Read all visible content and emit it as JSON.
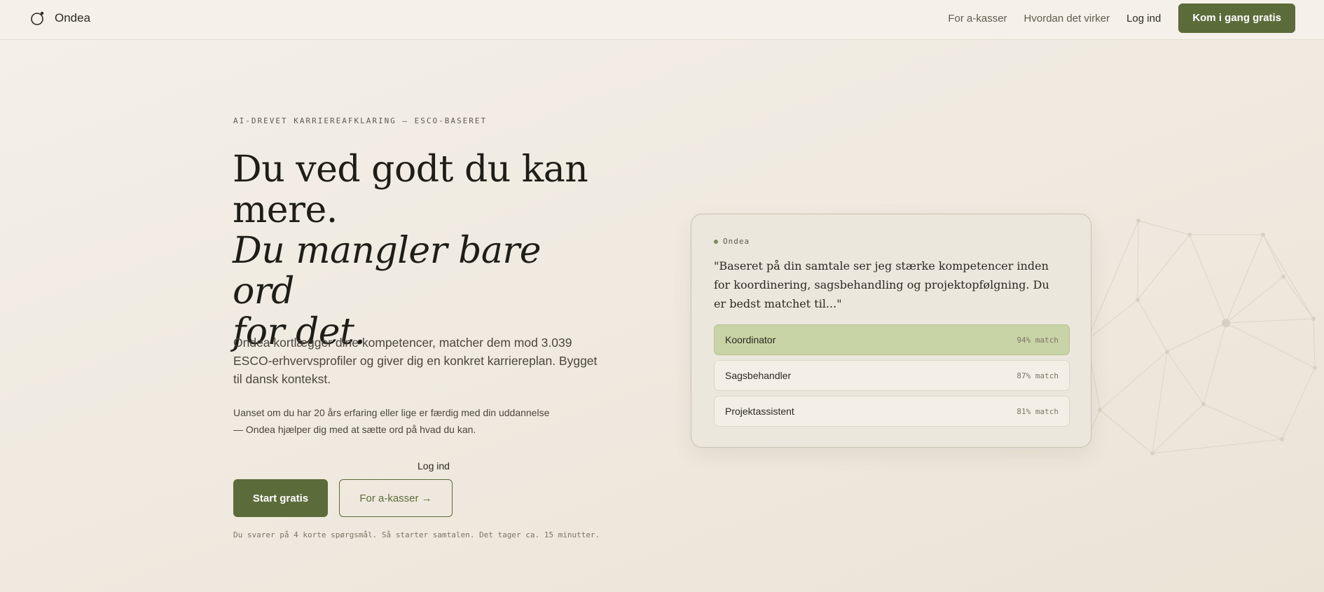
{
  "brand": {
    "name": "Ondea",
    "icon": "ondea-logo-icon"
  },
  "nav": {
    "links": [
      "For a-kasser",
      "Hvordan det virker"
    ],
    "login": "Log ind",
    "cta": "Kom i gang gratis"
  },
  "hero": {
    "eyebrow": "AI-DREVET KARRIEREAFKLARING — ESCO-BASERET",
    "headline_line1": "Du ved godt du kan",
    "headline_line2": "mere.",
    "headline_line3": "Du mangler bare ord",
    "headline_line4": "for det.",
    "lead": "Ondea kortlægger dine kompetencer, matcher dem mod 3.039 ESCO-erhvervsprofiler og giver dig en konkret karriereplan. Bygget til dansk kontekst.",
    "sub": "Uanset om du har 20 års erfaring eller lige er færdig med din uddannelse — Ondea hjælper dig med at sætte ord på hvad du kan.",
    "login_link": "Log ind",
    "primary_button": "Start gratis",
    "secondary_button": "For a-kasser →",
    "note": "Du svarer på 4 korte spørgsmål. Så starter samtalen. Det tager ca. 15 minutter."
  },
  "card": {
    "badge": "Ondea",
    "quote": "\"Baseret på din samtale ser jeg stærke kompetencer inden for koordinering, sagsbehandling og projektopfølgning. Du er bedst matchet til...\"",
    "matches": [
      {
        "name": "Koordinator",
        "score": "94% match"
      },
      {
        "name": "Sagsbehandler",
        "score": "87% match"
      },
      {
        "name": "Projektassistent",
        "score": "81% match"
      }
    ]
  },
  "colors": {
    "accent": "#5c6b3a",
    "highlight": "#c8d3a6",
    "background": "#f1ece3"
  }
}
